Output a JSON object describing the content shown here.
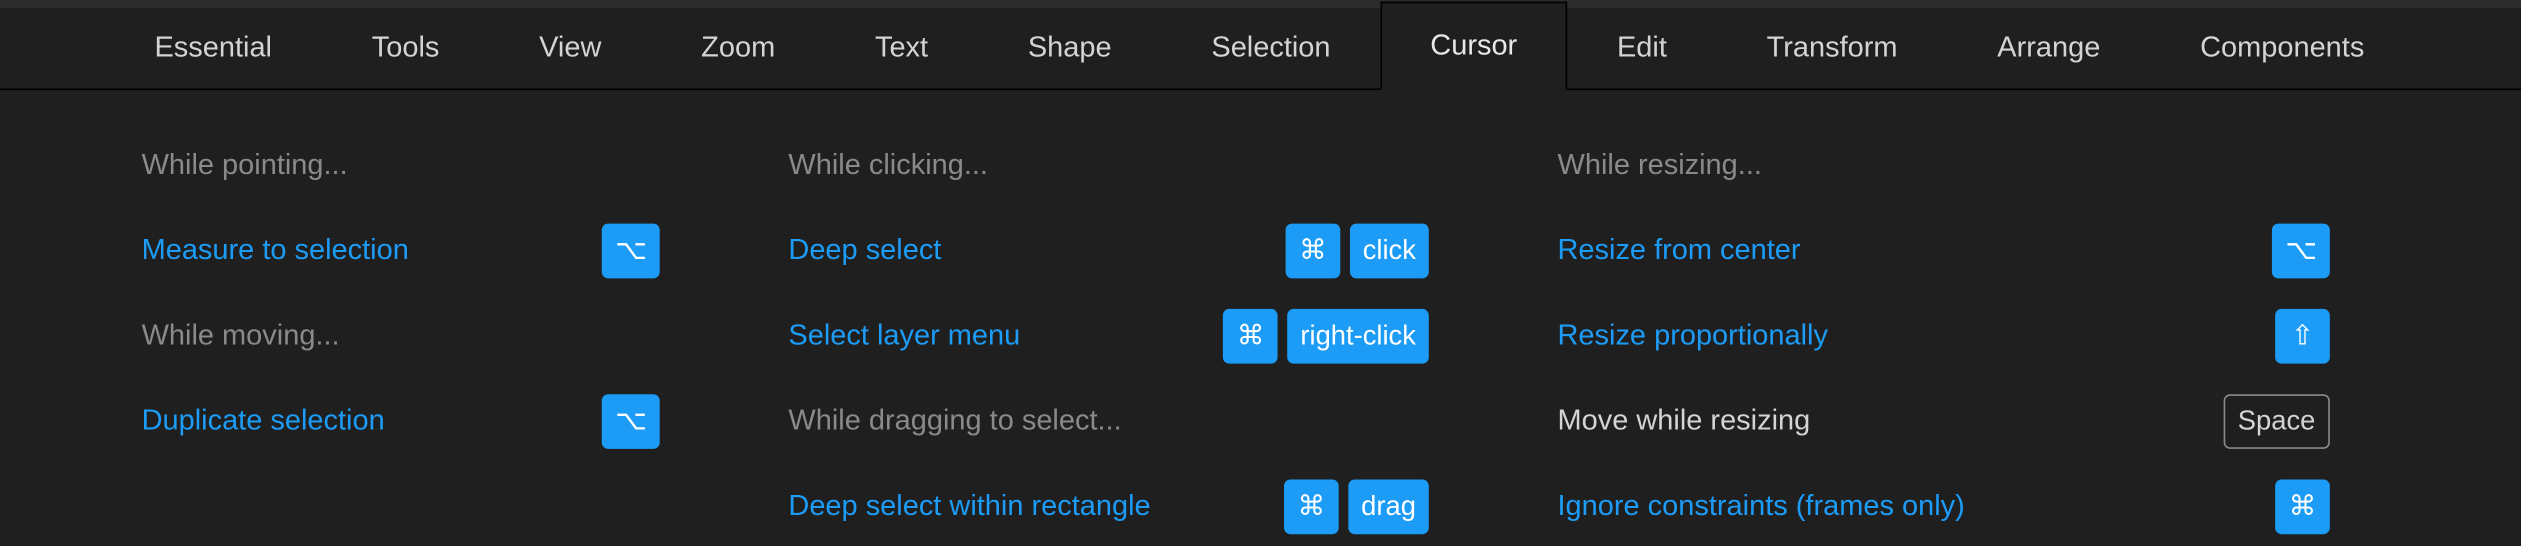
{
  "tabs": {
    "items": [
      {
        "label": "Essential"
      },
      {
        "label": "Tools"
      },
      {
        "label": "View"
      },
      {
        "label": "Zoom"
      },
      {
        "label": "Text"
      },
      {
        "label": "Shape"
      },
      {
        "label": "Selection"
      },
      {
        "label": "Cursor"
      },
      {
        "label": "Edit"
      },
      {
        "label": "Transform"
      },
      {
        "label": "Arrange"
      },
      {
        "label": "Components"
      }
    ],
    "active_index": 7
  },
  "glyphs": {
    "option": "⌥",
    "command": "⌘",
    "shift": "⇧"
  },
  "columns": [
    {
      "rows": [
        {
          "type": "group",
          "text": "While pointing..."
        },
        {
          "type": "action",
          "text": "Measure to selection",
          "keys": [
            {
              "glyph": "option"
            }
          ]
        },
        {
          "type": "group",
          "text": "While moving..."
        },
        {
          "type": "action",
          "text": "Duplicate selection",
          "keys": [
            {
              "glyph": "option"
            }
          ]
        }
      ]
    },
    {
      "rows": [
        {
          "type": "group",
          "text": "While clicking..."
        },
        {
          "type": "action",
          "text": "Deep select",
          "keys": [
            {
              "glyph": "command"
            },
            {
              "text": "click"
            }
          ]
        },
        {
          "type": "action",
          "text": "Select layer menu",
          "keys": [
            {
              "glyph": "command"
            },
            {
              "text": "right-click"
            }
          ]
        },
        {
          "type": "group",
          "text": "While dragging to select..."
        },
        {
          "type": "action",
          "text": "Deep select within rectangle",
          "keys": [
            {
              "glyph": "command"
            },
            {
              "text": "drag"
            }
          ]
        }
      ]
    },
    {
      "rows": [
        {
          "type": "group",
          "text": "While resizing..."
        },
        {
          "type": "action",
          "text": "Resize from center",
          "keys": [
            {
              "glyph": "option"
            }
          ]
        },
        {
          "type": "action",
          "text": "Resize proportionally",
          "keys": [
            {
              "glyph": "shift"
            }
          ]
        },
        {
          "type": "action",
          "muted": true,
          "text": "Move while resizing",
          "keys": [
            {
              "text": "Space",
              "outline": true
            }
          ]
        },
        {
          "type": "action",
          "text": "Ignore constraints (frames only)",
          "keys": [
            {
              "glyph": "command"
            }
          ]
        }
      ]
    }
  ]
}
